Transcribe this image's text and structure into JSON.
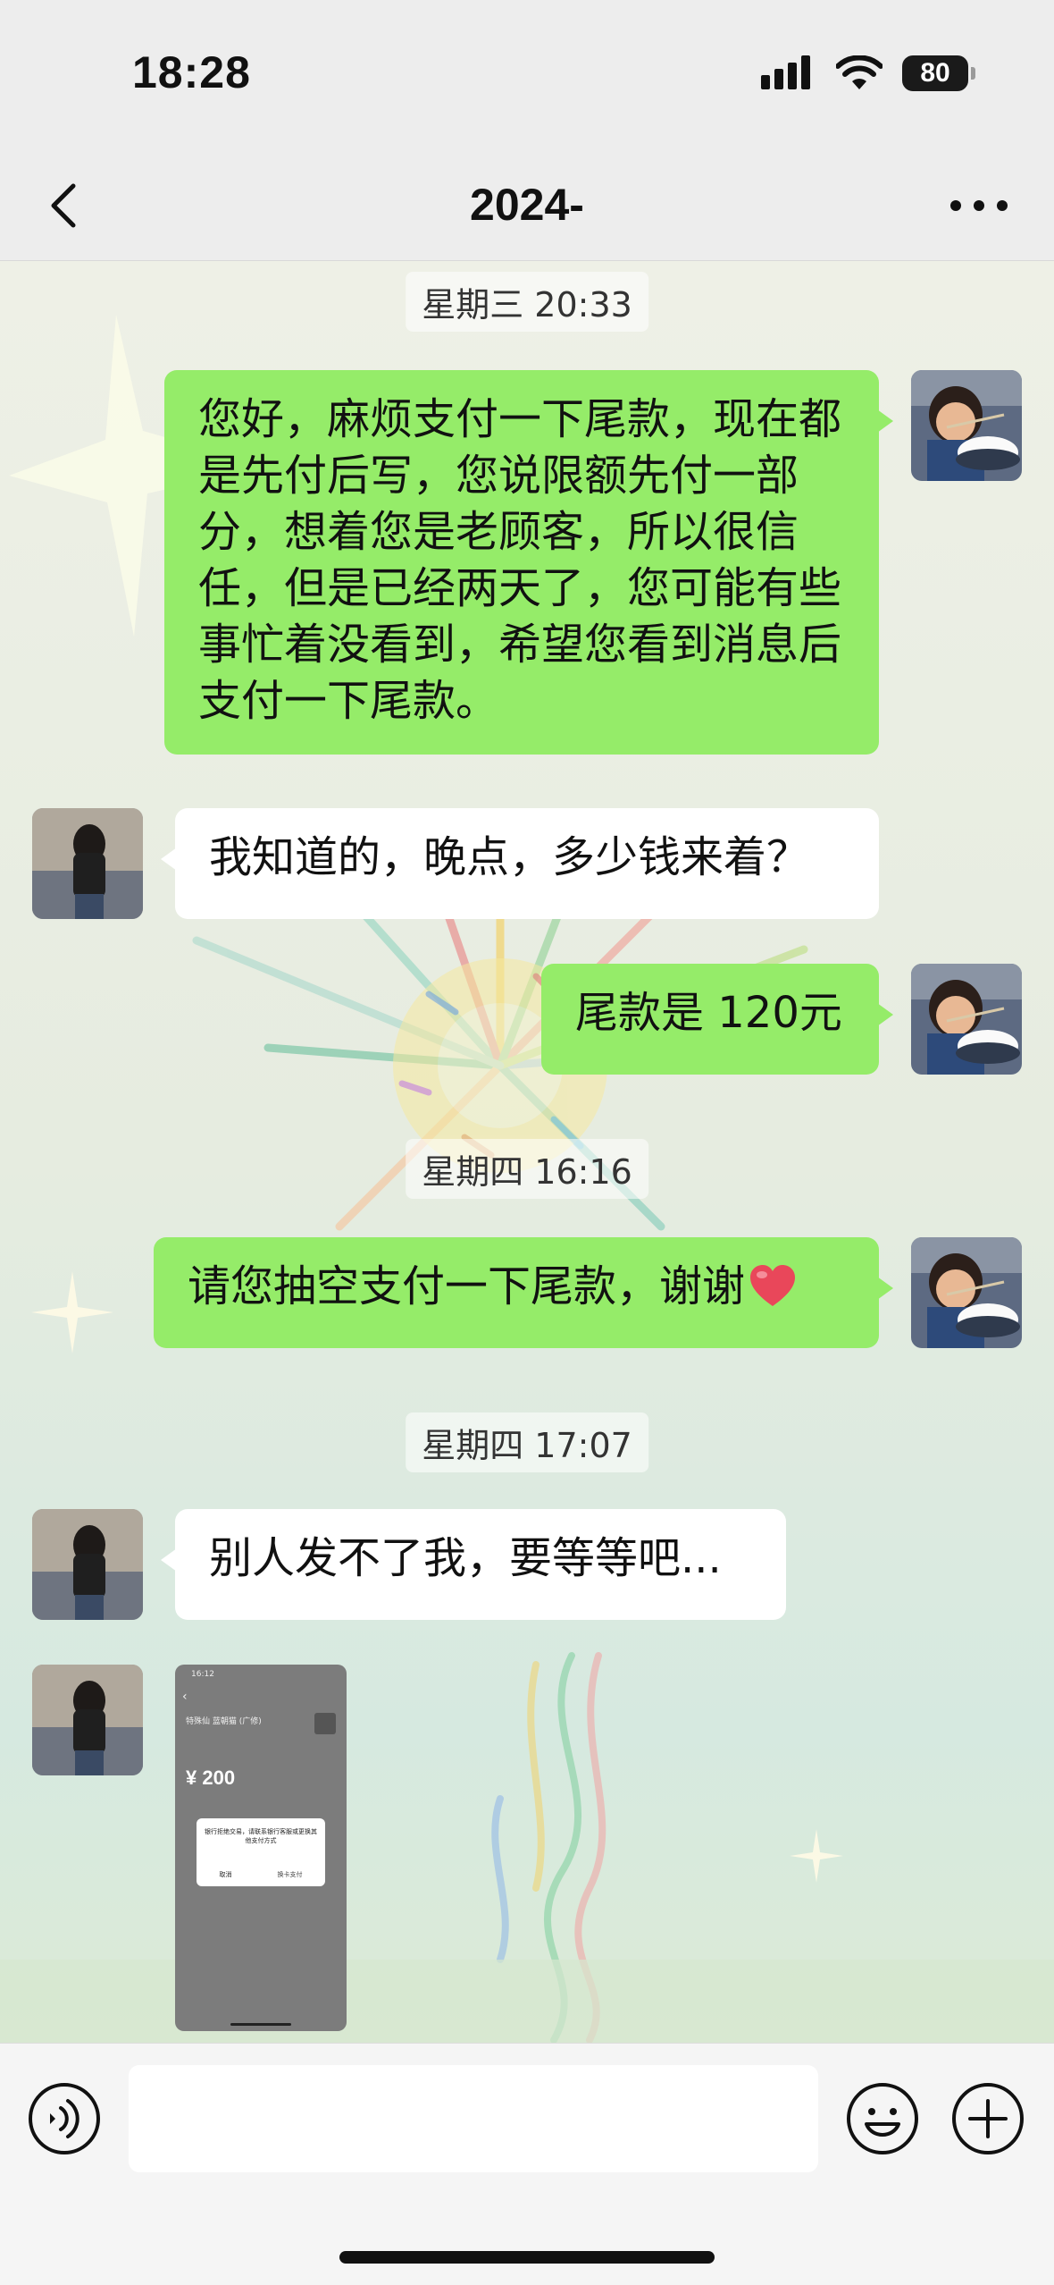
{
  "status_bar": {
    "time": "18:28",
    "battery": "80"
  },
  "nav": {
    "title": "2024-"
  },
  "chat": {
    "timestamps": [
      "星期三 20:33",
      "星期四 16:16",
      "星期四 17:07"
    ],
    "messages": [
      {
        "side": "out",
        "text": "您好，麻烦支付一下尾款，现在都是先付后写，您说限额先付一部分，想着您是老顾客，所以很信任，但是已经两天了，您可能有些事忙着没看到，希望您看到消息后支付一下尾款。"
      },
      {
        "side": "in",
        "text": "我知道的，晚点，多少钱来着？"
      },
      {
        "side": "out",
        "text": "尾款是 120元"
      },
      {
        "side": "out",
        "text": "请您抽空支付一下尾款，谢谢",
        "emoji": "heart-icon"
      },
      {
        "side": "in",
        "text": "别人发不了我，要等等吧..."
      },
      {
        "side": "in",
        "type": "image"
      }
    ]
  },
  "image_message": {
    "status_time": "16:12",
    "merchant": "特殊仙 蓝朝猫 (广修)",
    "amount": "¥ 200",
    "dialog_text": "银行拒绝交易，请联系银行客服或更换其他支付方式",
    "cancel": "取消",
    "ok": "换卡支付"
  },
  "input_bar": {
    "placeholder": ""
  },
  "colors": {
    "outgoing_bubble": "#95ec69",
    "incoming_bubble": "#ffffff",
    "bar": "#ededed"
  }
}
